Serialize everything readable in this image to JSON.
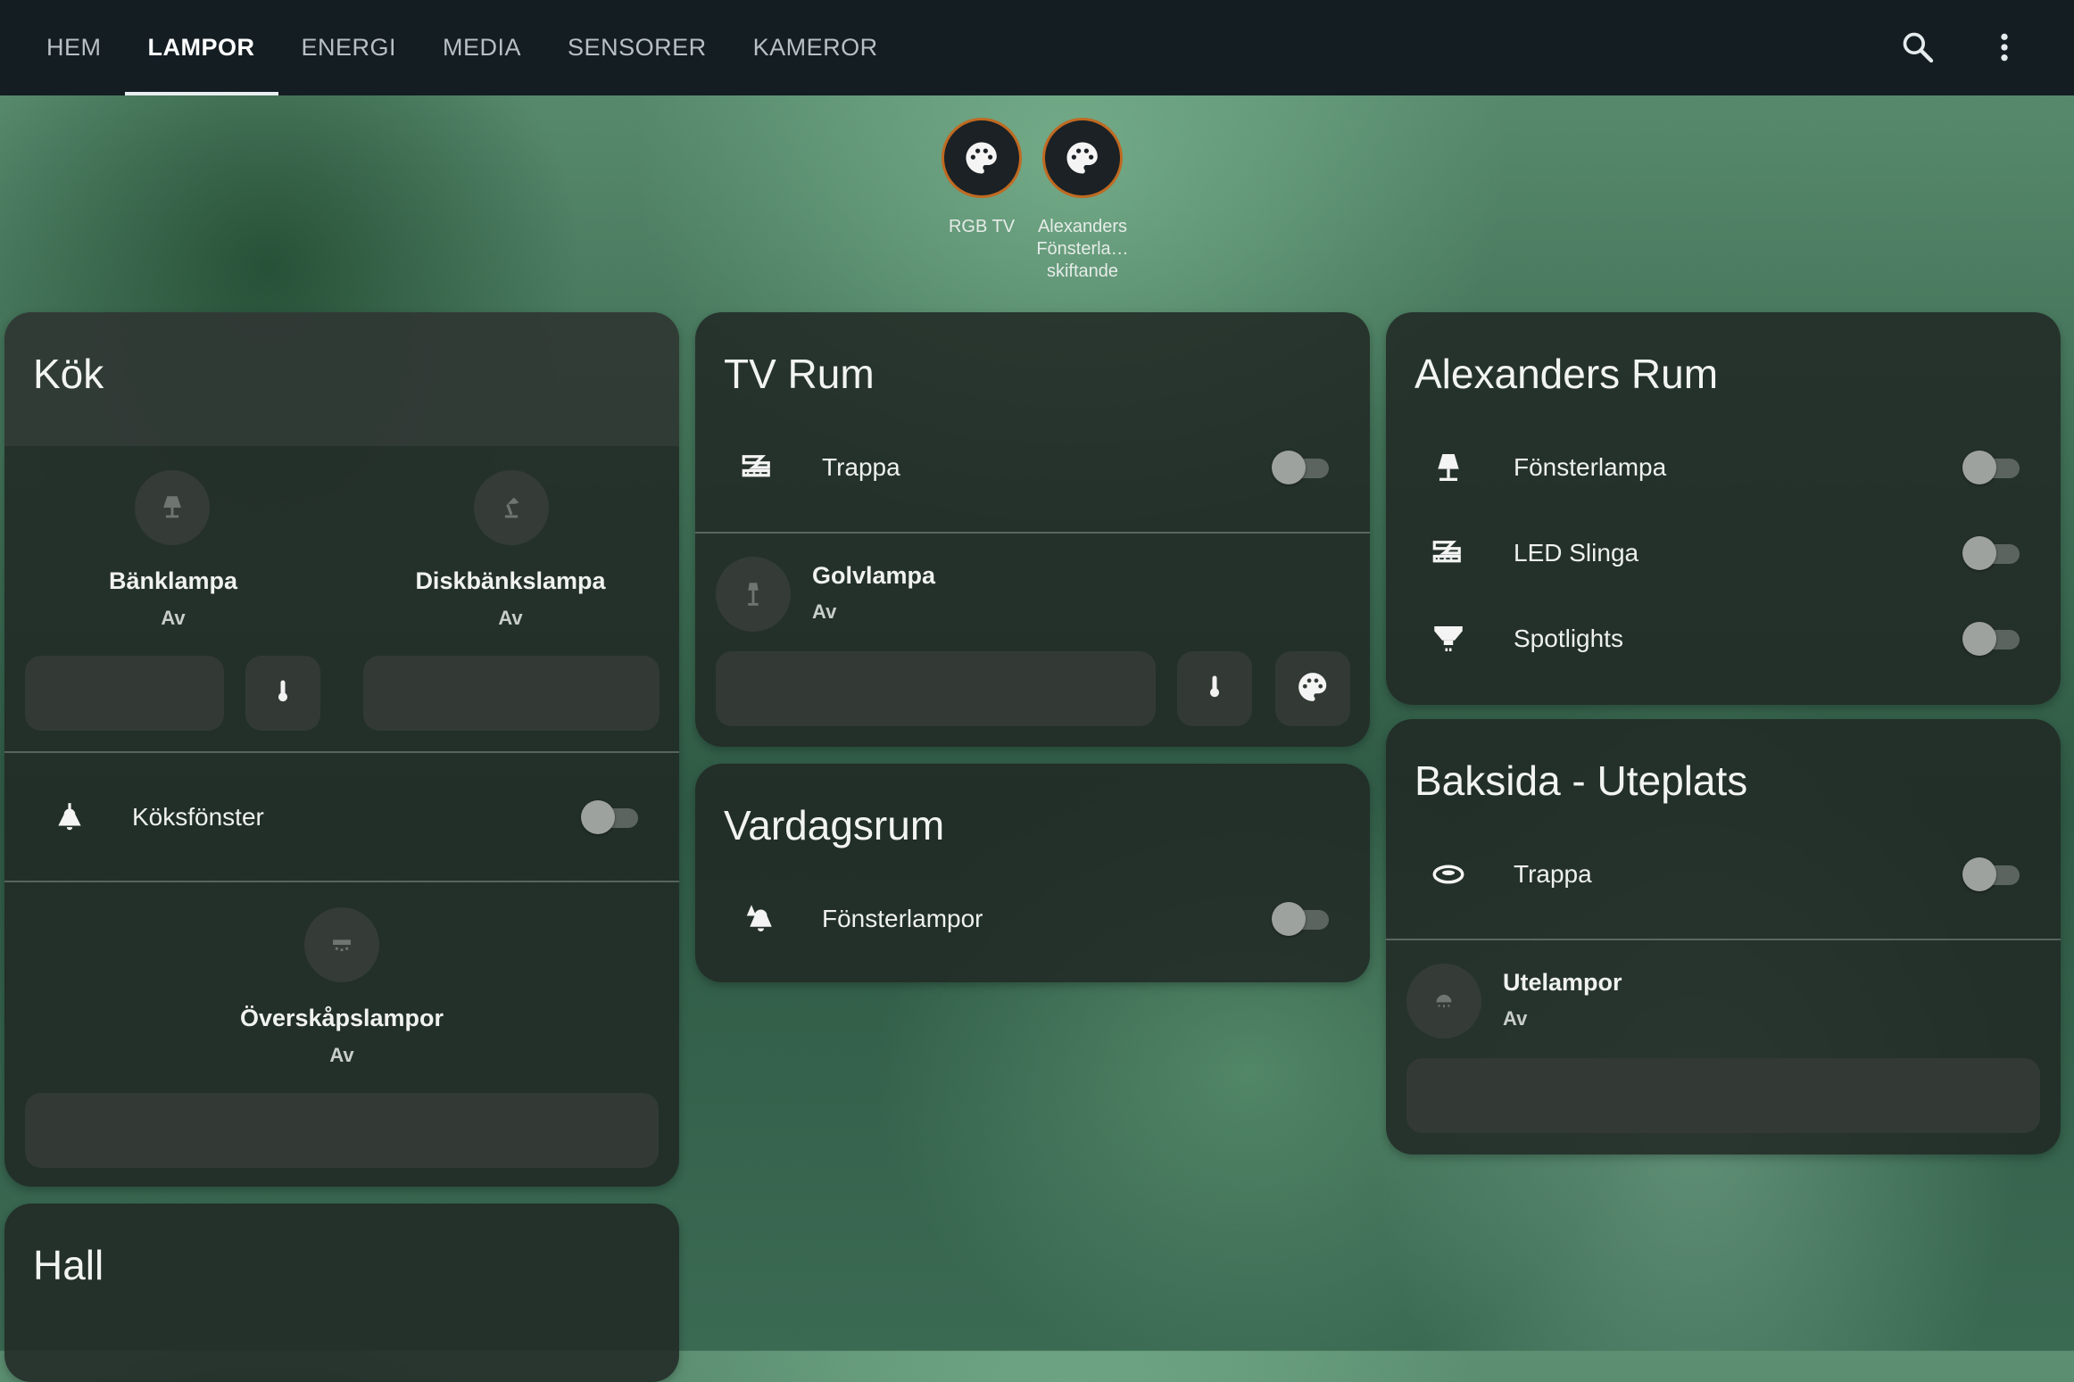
{
  "tabs": [
    "HEM",
    "LAMPOR",
    "ENERGI",
    "MEDIA",
    "SENSORER",
    "KAMEROR"
  ],
  "active_tab": "LAMPOR",
  "header_icons": [
    "search-icon",
    "more-vert-icon"
  ],
  "scenes": [
    {
      "label": "RGB TV",
      "icon": "palette-icon"
    },
    {
      "label": "Alexanders Fönsterla… skiftande",
      "icon": "palette-icon"
    }
  ],
  "colors": {
    "accent_ring": "#c06a22",
    "topbar": "#141d22",
    "card": "#212824"
  },
  "kok": {
    "title": "Kök",
    "tiles": [
      {
        "name": "Bänklampa",
        "state": "Av",
        "icon": "table-lamp-icon"
      },
      {
        "name": "Diskbänkslampa",
        "state": "Av",
        "icon": "desk-lamp-icon"
      }
    ],
    "row": {
      "label": "Köksfönster",
      "icon": "ceiling-light-icon",
      "on": false
    },
    "tile2": {
      "name": "Överskåpslampor",
      "state": "Av",
      "icon": "cabinet-light-icon"
    }
  },
  "hall": {
    "title": "Hall"
  },
  "tvrum": {
    "title": "TV Rum",
    "row": {
      "label": "Trappa",
      "icon": "led-strip-icon",
      "on": false
    },
    "tile": {
      "name": "Golvlampa",
      "state": "Av",
      "icon": "floor-lamp-icon"
    }
  },
  "vardagsrum": {
    "title": "Vardagsrum",
    "row": {
      "label": "Fönsterlampor",
      "icon": "multi-light-icon",
      "on": false
    }
  },
  "alexanders": {
    "title": "Alexanders Rum",
    "rows": [
      {
        "label": "Fönsterlampa",
        "icon": "lamp-icon",
        "on": false
      },
      {
        "label": "LED Slinga",
        "icon": "led-strip-icon",
        "on": false
      },
      {
        "label": "Spotlights",
        "icon": "spotlight-icon",
        "on": false
      }
    ]
  },
  "baksida": {
    "title": "Baksida - Uteplats",
    "row": {
      "label": "Trappa",
      "icon": "ring-light-icon",
      "on": false
    },
    "tile": {
      "name": "Utelampor",
      "state": "Av",
      "icon": "outdoor-light-icon"
    }
  }
}
